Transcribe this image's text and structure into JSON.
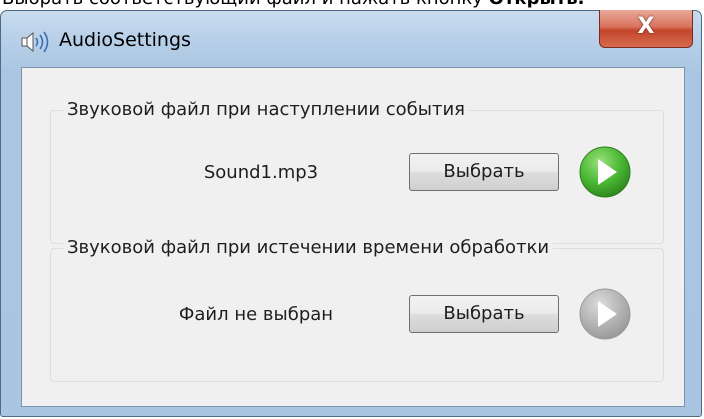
{
  "top_text": {
    "normal": "Выбрать соответствующий файл и нажать кнопку ",
    "bold": "Открыть."
  },
  "window": {
    "title": "AudioSettings",
    "icon": "speaker-icon",
    "close_label": "X"
  },
  "groups": [
    {
      "label": "Звуковой файл при наступлении события",
      "file": "Sound1.mp3",
      "button_label": "Выбрать",
      "play_state": "enabled",
      "play_color": "#4ab833"
    },
    {
      "label": "Звуковой файл при истечении времени обработки",
      "file": "Файл не выбран",
      "button_label": "Выбрать",
      "play_state": "disabled",
      "play_color": "#b4b4b4"
    }
  ]
}
